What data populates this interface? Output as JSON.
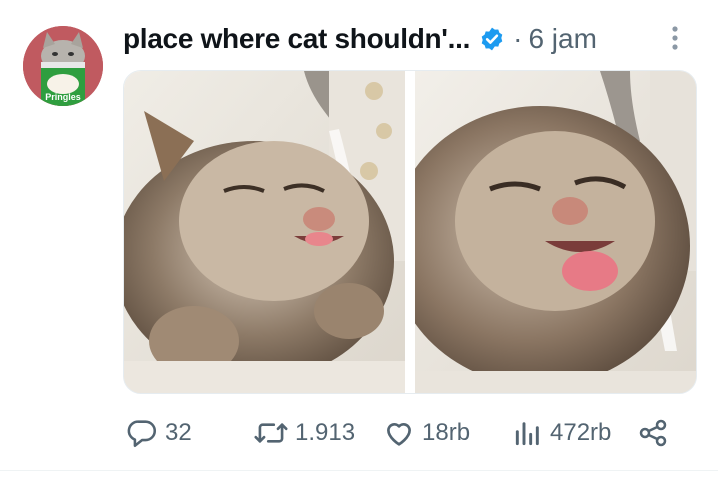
{
  "post": {
    "author": "place where cat shouldn'...",
    "separator": "·",
    "time": "6 jam",
    "media": {
      "image1": "cat with tongue out drinking from faucet",
      "image2": "cat close-up licking water stream"
    },
    "avatar": {
      "label": "Pringles"
    },
    "actions": {
      "replies": "32",
      "reposts": "1.913",
      "likes": "18rb",
      "views": "472rb"
    }
  },
  "icons": {
    "verified": "verified-badge-icon",
    "more": "more-vertical-icon",
    "reply": "reply-icon",
    "repost": "repost-icon",
    "like": "heart-icon",
    "views": "views-icon",
    "share": "share-icon"
  },
  "colors": {
    "verified": "#1d9bf0",
    "muted": "#536471",
    "text": "#0f1419"
  }
}
